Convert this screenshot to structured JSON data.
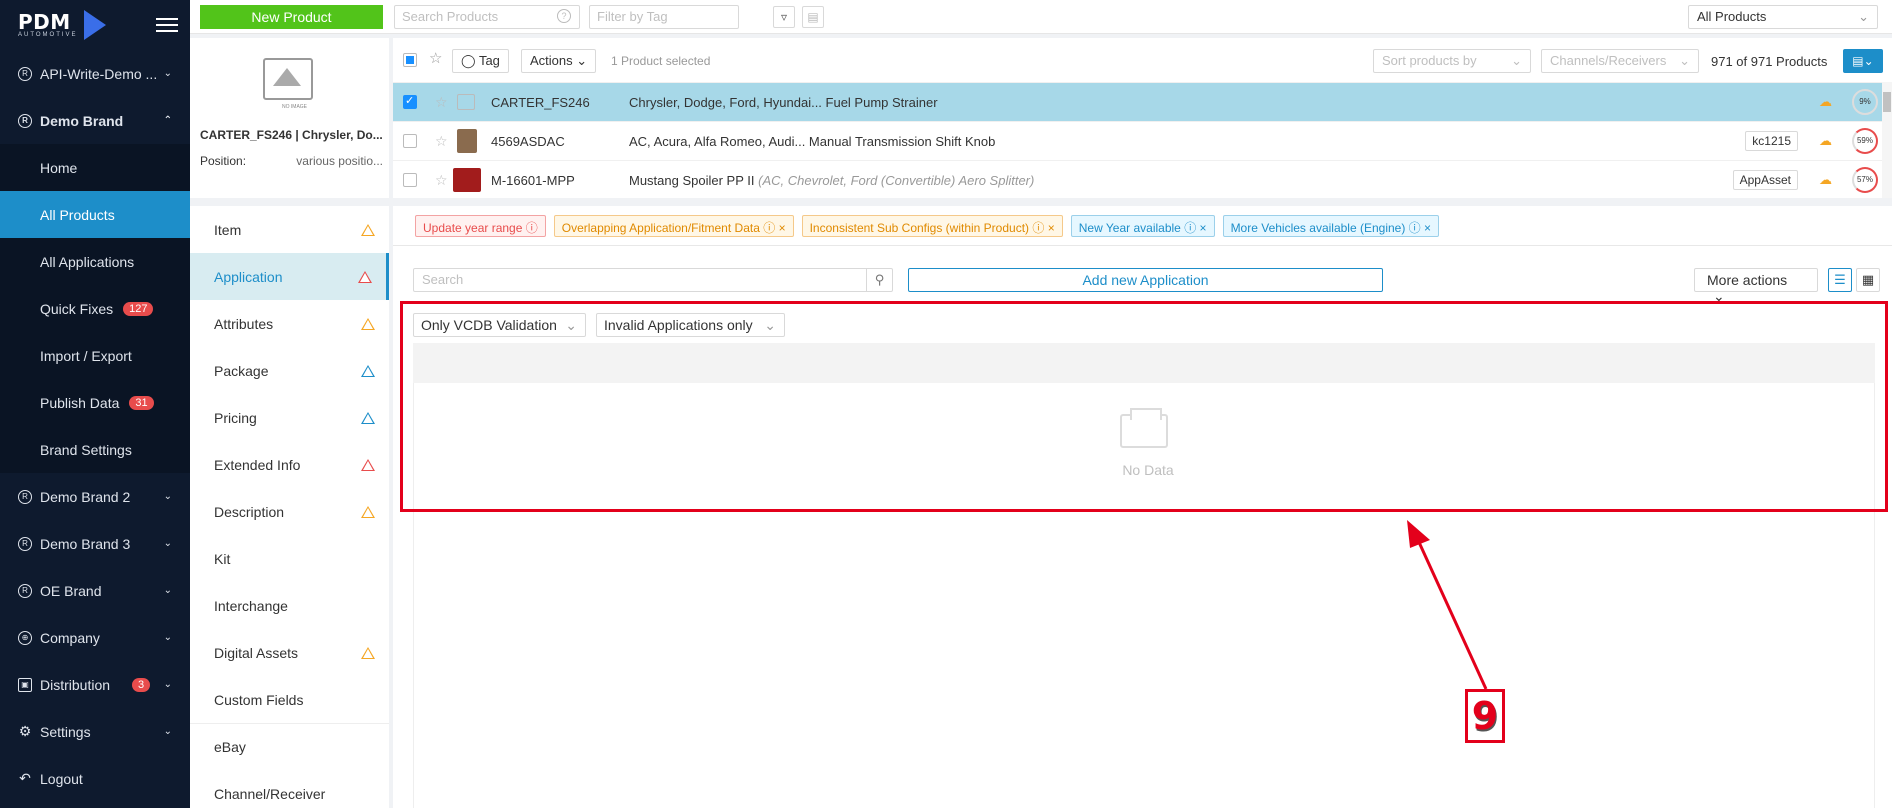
{
  "sidebar": {
    "logo_main": "PDM",
    "logo_sub": "AUTOMOTIVE",
    "items": [
      {
        "label": "API-Write-Demo ...",
        "icon": "registered-icon"
      },
      {
        "label": "Demo Brand",
        "icon": "registered-icon"
      },
      {
        "label": "Demo Brand 2",
        "icon": "registered-icon"
      },
      {
        "label": "Demo Brand 3",
        "icon": "registered-icon"
      },
      {
        "label": "OE Brand",
        "icon": "registered-icon"
      },
      {
        "label": "Company",
        "icon": "globe-icon"
      },
      {
        "label": "Distribution",
        "icon": "distribution-icon",
        "badge": "3"
      },
      {
        "label": "Settings",
        "icon": "gear-icon"
      },
      {
        "label": "Logout",
        "icon": "logout-icon"
      }
    ],
    "subitems": [
      {
        "label": "Home"
      },
      {
        "label": "All Products"
      },
      {
        "label": "All Applications"
      },
      {
        "label": "Quick Fixes",
        "badge": "127"
      },
      {
        "label": "Import / Export"
      },
      {
        "label": "Publish Data",
        "badge": "31"
      },
      {
        "label": "Brand Settings"
      }
    ]
  },
  "topbar": {
    "new_product": "New Product",
    "search_placeholder": "Search Products",
    "tag_placeholder": "Filter by Tag",
    "scope": "All Products"
  },
  "product_side": {
    "noimage_label": "NO IMAGE",
    "title": "CARTER_FS246 | Chrysler, Do...",
    "position_label": "Position:",
    "position_value": "various positio..."
  },
  "product_list": {
    "tag_button": "Tag",
    "actions_button": "Actions",
    "selected_text": "1 Product selected",
    "sort_placeholder": "Sort products by",
    "channels_placeholder": "Channels/Receivers",
    "count": "971 of 971 Products",
    "rows": [
      {
        "part": "CARTER_FS246",
        "desc": "Chrysler, Dodge, Ford, Hyundai... Fuel Pump Strainer",
        "desc_italic": "",
        "tag": "",
        "pct": "9%"
      },
      {
        "part": "4569ASDAC",
        "desc": "AC, Acura, Alfa Romeo, Audi... Manual Transmission Shift Knob",
        "desc_italic": "",
        "tag": "kc1215",
        "pct": "59%"
      },
      {
        "part": "M-16601-MPP",
        "desc": "Mustang Spoiler PP II ",
        "desc_italic": "(AC, Chevrolet, Ford (Convertible) Aero Splitter)",
        "tag": "AppAsset",
        "pct": "57%"
      }
    ]
  },
  "sections": [
    {
      "label": "Item",
      "warn": "orange"
    },
    {
      "label": "Application",
      "warn": "red"
    },
    {
      "label": "Attributes",
      "warn": "orange"
    },
    {
      "label": "Package",
      "warn": "blue"
    },
    {
      "label": "Pricing",
      "warn": "blue"
    },
    {
      "label": "Extended Info",
      "warn": "red"
    },
    {
      "label": "Description",
      "warn": "orange"
    },
    {
      "label": "Kit",
      "warn": ""
    },
    {
      "label": "Interchange",
      "warn": ""
    },
    {
      "label": "Digital Assets",
      "warn": "orange"
    },
    {
      "label": "Custom Fields",
      "warn": ""
    },
    {
      "label": "eBay",
      "warn": ""
    },
    {
      "label": "Channel/Receiver",
      "warn": ""
    }
  ],
  "flags": [
    {
      "label": "Update year range",
      "color": "red"
    },
    {
      "label": "Overlapping Application/Fitment Data",
      "color": "orange"
    },
    {
      "label": "Inconsistent Sub Configs (within Product)",
      "color": "orange"
    },
    {
      "label": "New Year available",
      "color": "blue"
    },
    {
      "label": "More Vehicles available (Engine)",
      "color": "blue"
    }
  ],
  "application": {
    "search_placeholder": "Search",
    "add_button": "Add new Application",
    "more_actions": "More actions",
    "validation_select": "Only VCDB Validation",
    "filter_select": "Invalid Applications only",
    "empty_text": "No Data"
  },
  "annotation": {
    "step": "9"
  },
  "colors": {
    "accent": "#1d8ec9",
    "sidebar_bg": "#0e1a2e",
    "new_button": "#52c41a",
    "annotation": "#e3001b"
  }
}
